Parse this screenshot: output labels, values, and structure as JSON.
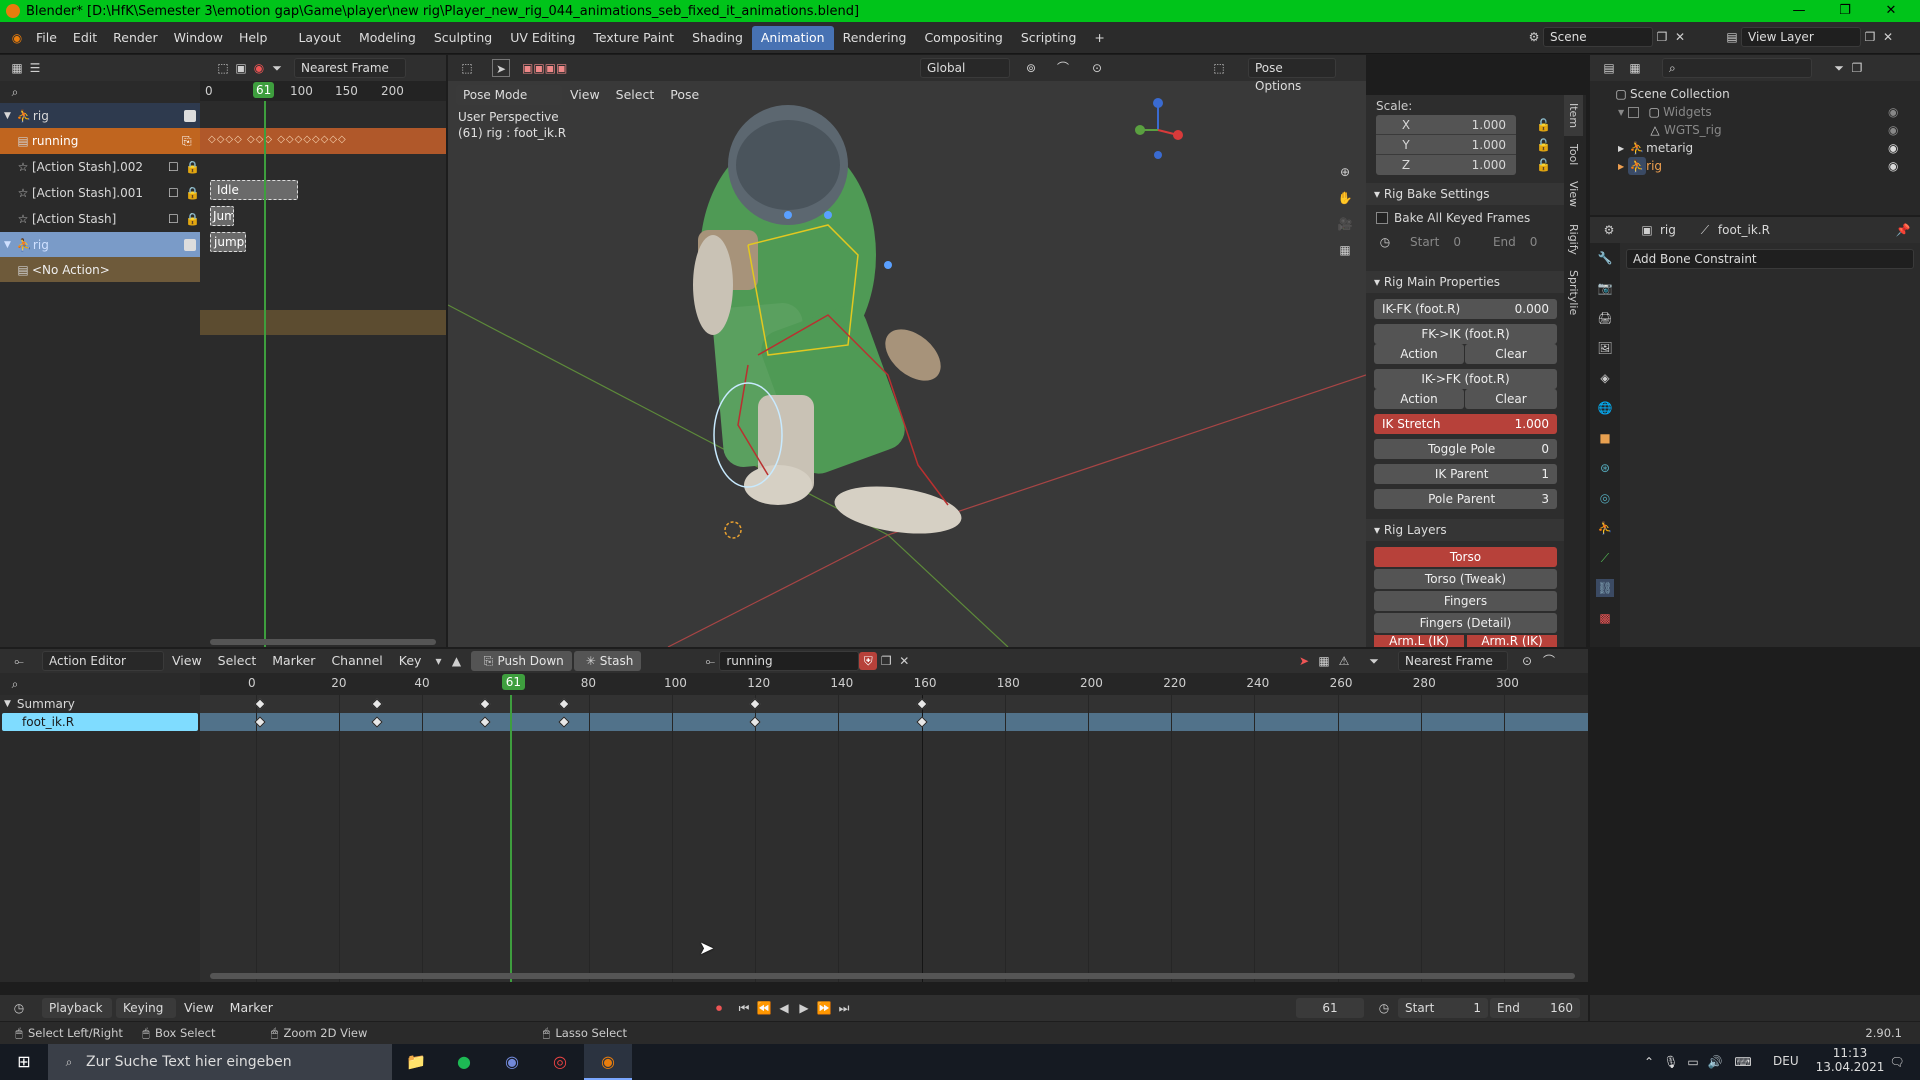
{
  "window": {
    "title": "Blender* [D:\\HfK\\Semester 3\\emotion gap\\Game\\player\\new rig\\Player_new_rig_044_animations_seb_fixed_it_animations.blend]",
    "min": "—",
    "max": "❐",
    "close": "✕"
  },
  "menu": [
    "File",
    "Edit",
    "Render",
    "Window",
    "Help"
  ],
  "workspaces": [
    "Layout",
    "Modeling",
    "Sculpting",
    "UV Editing",
    "Texture Paint",
    "Shading",
    "Animation",
    "Rendering",
    "Compositing",
    "Scripting",
    "+"
  ],
  "active_workspace": "Animation",
  "scene": {
    "name": "Scene",
    "view_layer": "View Layer"
  },
  "nla": {
    "snap": "Nearest Frame",
    "ruler": [
      "0",
      "61",
      "100",
      "150",
      "200"
    ],
    "rows": [
      {
        "label": "rig"
      },
      {
        "label": "running"
      },
      {
        "label": "[Action Stash].002"
      },
      {
        "label": "[Action Stash].001"
      },
      {
        "label": "[Action Stash]"
      },
      {
        "label": "rig"
      },
      {
        "label": "<No Action>"
      }
    ],
    "strips": [
      "Idle",
      "Jum",
      "jump"
    ]
  },
  "viewport": {
    "mode": "Pose Mode",
    "menus": [
      "View",
      "Select",
      "Pose"
    ],
    "orientation": "Global",
    "pose_options": "Pose Options",
    "info1": "User Perspective",
    "info2": "(61) rig : foot_ik.R",
    "tabs": [
      "Item",
      "Tool",
      "View",
      "Rigify",
      "Spritylie"
    ]
  },
  "sidebar": {
    "scale_label": "Scale:",
    "scale": [
      {
        "axis": "X",
        "value": "1.000"
      },
      {
        "axis": "Y",
        "value": "1.000"
      },
      {
        "axis": "Z",
        "value": "1.000"
      }
    ],
    "bake_header": "Rig Bake Settings",
    "bake_all": "Bake All Keyed Frames",
    "start_label": "Start",
    "start_val": "0",
    "end_label": "End",
    "end_val": "0",
    "main_header": "Rig Main Properties",
    "ikfk_label": "IK-FK (foot.R)",
    "ikfk_val": "0.000",
    "fk2ik": "FK->IK (foot.R)",
    "ik2fk": "IK->FK (foot.R)",
    "action": "Action",
    "clear": "Clear",
    "ik_stretch": "IK Stretch",
    "ik_stretch_val": "1.000",
    "toggle_pole": "Toggle Pole",
    "toggle_pole_val": "0",
    "ik_parent": "IK Parent",
    "ik_parent_val": "1",
    "pole_parent": "Pole Parent",
    "pole_parent_val": "3",
    "layers_header": "Rig Layers",
    "layers": [
      "Torso",
      "Torso (Tweak)",
      "Fingers",
      "Fingers (Detail)",
      "Arm.L (IK)",
      "Arm.R (IK)"
    ]
  },
  "outliner": {
    "root": "Scene Collection",
    "items": [
      "Widgets",
      "WGTS_rig",
      "metarig",
      "rig"
    ]
  },
  "properties": {
    "bc_object": "rig",
    "bc_bone": "foot_ik.R",
    "add_constraint": "Add Bone Constraint"
  },
  "action_editor": {
    "mode": "Action Editor",
    "menus": [
      "View",
      "Select",
      "Marker",
      "Channel",
      "Key"
    ],
    "push_down": "Push Down",
    "stash": "Stash",
    "action_name": "running",
    "snap": "Nearest Frame",
    "ruler": [
      "0",
      "20",
      "40",
      "61",
      "80",
      "100",
      "120",
      "140",
      "160",
      "180",
      "200",
      "220",
      "240",
      "260",
      "280",
      "300"
    ],
    "channels": [
      "Summary",
      "foot_ik.R"
    ],
    "keyframes": [
      1,
      29,
      55,
      74,
      120,
      160
    ]
  },
  "timeline": {
    "menus": [
      "Playback",
      "Keying",
      "View",
      "Marker"
    ],
    "current": "61",
    "start_label": "Start",
    "start": "1",
    "end_label": "End",
    "end": "160"
  },
  "statusbar": {
    "items": [
      "Select Left/Right",
      "Box Select",
      "Zoom 2D View",
      "Lasso Select"
    ],
    "version": "2.90.1"
  },
  "taskbar": {
    "search": "Zur Suche Text hier eingeben",
    "lang": "DEU",
    "time": "11:13",
    "date": "13.04.2021"
  },
  "colors": {
    "accent": "#4772b3",
    "playhead": "#3e9e3e",
    "title_bar": "#00c41a",
    "red_prop": "#b7413a",
    "selected_channel": "#7fdcff"
  }
}
